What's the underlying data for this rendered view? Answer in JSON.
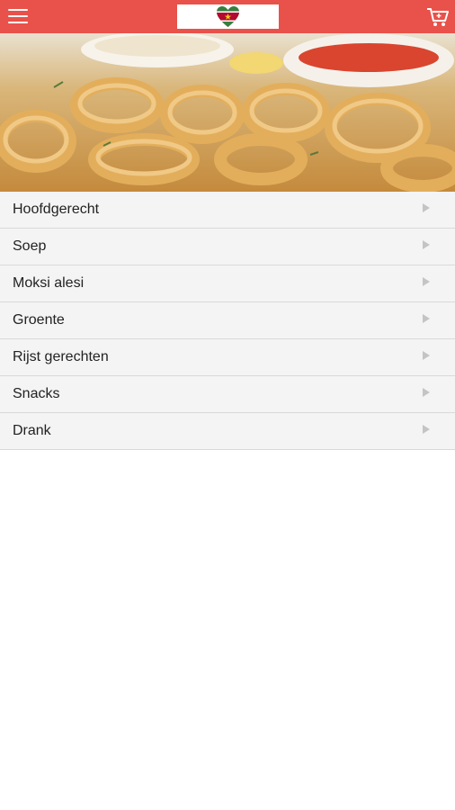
{
  "header": {
    "menu_icon": "hamburger-menu-icon",
    "logo_icon": "suriname-flag-heart-logo",
    "cart_icon": "shopping-cart-icon",
    "bar_color": "#e8524a"
  },
  "hero": {
    "image": "fried-calamari-with-dipping-sauces"
  },
  "menu": {
    "items": [
      {
        "label": "Hoofdgerecht"
      },
      {
        "label": "Soep"
      },
      {
        "label": "Moksi alesi"
      },
      {
        "label": "Groente"
      },
      {
        "label": "Rijst gerechten"
      },
      {
        "label": "Snacks"
      },
      {
        "label": "Drank"
      }
    ],
    "arrow_icon": "chevron-right-icon"
  }
}
